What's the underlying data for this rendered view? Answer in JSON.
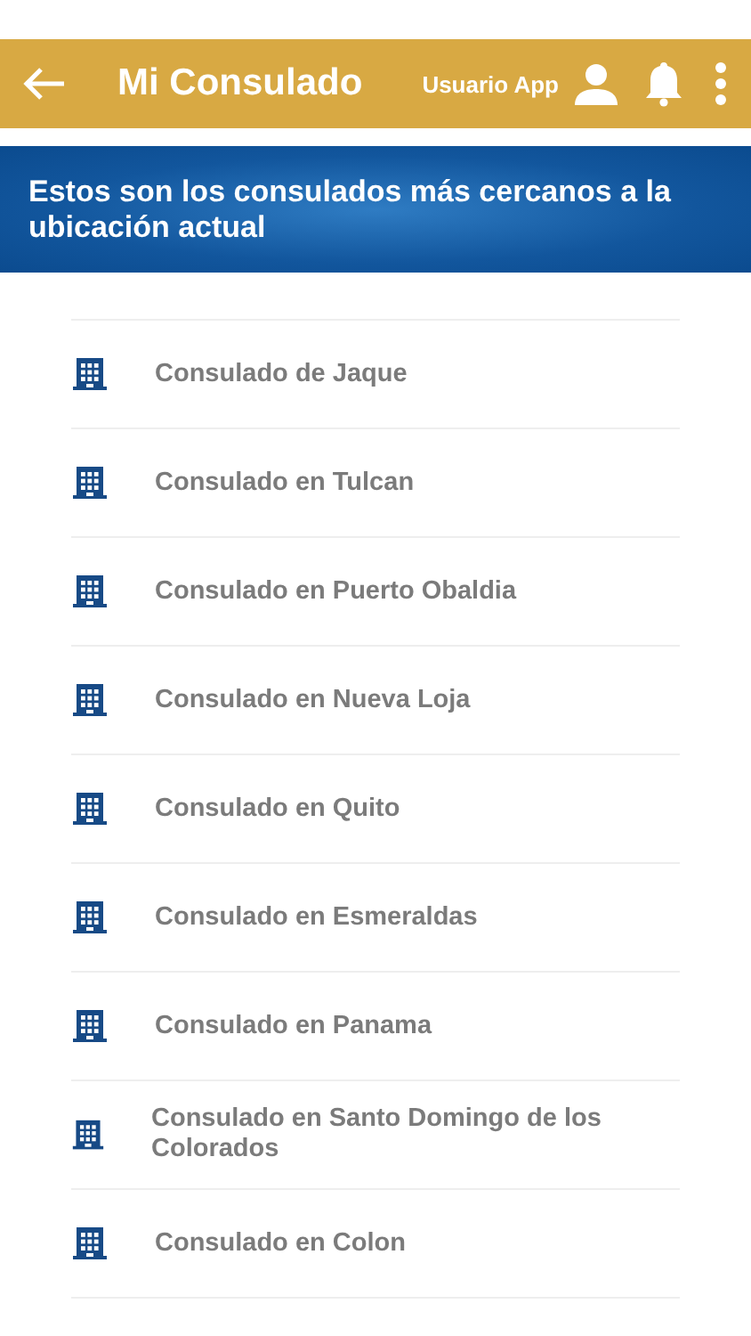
{
  "header": {
    "title": "Mi Consulado",
    "user": "Usuario App"
  },
  "banner": {
    "text": "Estos son los consulados más cercanos a la ubicación actual"
  },
  "consulates": [
    {
      "name": "Consulado de Jaque"
    },
    {
      "name": "Consulado en Tulcan"
    },
    {
      "name": "Consulado en Puerto Obaldia"
    },
    {
      "name": "Consulado en Nueva Loja"
    },
    {
      "name": "Consulado en Quito"
    },
    {
      "name": "Consulado en Esmeraldas"
    },
    {
      "name": "Consulado en Panama"
    },
    {
      "name": "Consulado en Santo Domingo de los Colorados"
    },
    {
      "name": "Consulado en Colon"
    }
  ]
}
